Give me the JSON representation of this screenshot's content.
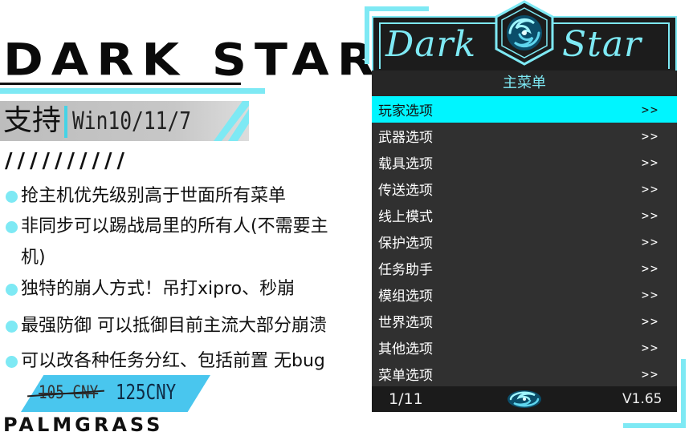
{
  "promo": {
    "brand_title": "DARK STAR",
    "support_label": "支持",
    "support_os": "Win10/11/7",
    "slashes": "//////////",
    "features": [
      "抢主机优先级别高于世面所有菜单",
      "非同步可以踢战局里的所有人(不需要主",
      "机)",
      " 独特的崩人方式！吊打xipro、秒崩",
      " 最强防御 可以抵御目前主流大部分崩溃",
      "可以改各种任务分红、包括前置 无bug"
    ],
    "price_old": "105 CNY",
    "price_new": "125CNY",
    "footer_brand": "PALMGRASS"
  },
  "menu": {
    "logo_left": "Dark",
    "logo_right": "Star",
    "title": "主菜单",
    "items": [
      {
        "label": "玩家选项",
        "arrow": ">>"
      },
      {
        "label": "武器选项",
        "arrow": ">>"
      },
      {
        "label": "载具选项",
        "arrow": ">>"
      },
      {
        "label": "传送选项",
        "arrow": ">>"
      },
      {
        "label": "线上模式",
        "arrow": ">>"
      },
      {
        "label": "保护选项",
        "arrow": ">>"
      },
      {
        "label": "任务助手",
        "arrow": ">>"
      },
      {
        "label": "模组选项",
        "arrow": ">>"
      },
      {
        "label": "世界选项",
        "arrow": ">>"
      },
      {
        "label": "其他选项",
        "arrow": ">>"
      },
      {
        "label": "菜单选项",
        "arrow": ">>"
      }
    ],
    "page": "1/11",
    "version": "V1.65"
  },
  "colors": {
    "accent": "#7ee9f4",
    "selected": "#00f5ff",
    "panel": "#303030",
    "price_tag": "#49c6ee"
  },
  "icons": [
    "swirl-logo-icon",
    "swirl-footer-icon",
    "bullet-dot-icon"
  ]
}
